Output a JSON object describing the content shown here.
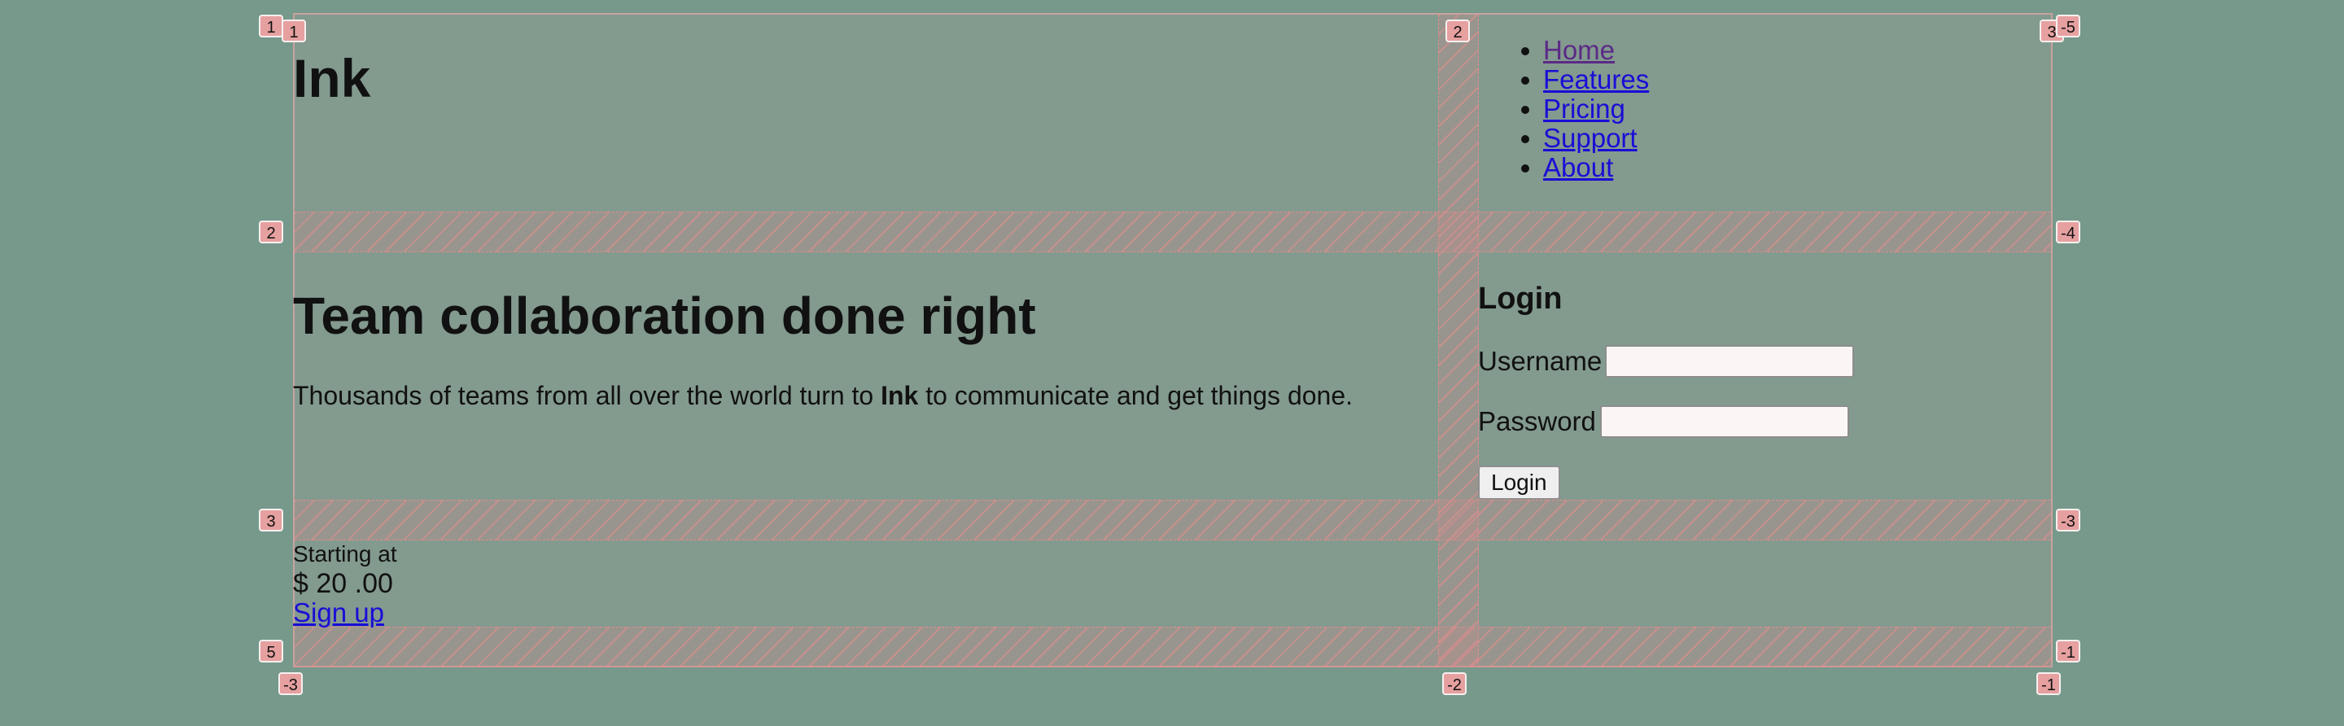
{
  "header": {
    "site_title": "Ink",
    "nav": [
      "Home",
      "Features",
      "Pricing",
      "Support",
      "About"
    ]
  },
  "hero": {
    "title": "Team collaboration done right",
    "text_before": "Thousands of teams from all over the world turn to ",
    "text_brand": "Ink",
    "text_after": " to communicate and get things done."
  },
  "login": {
    "title": "Login",
    "username_label": "Username",
    "username_value": "",
    "password_label": "Password",
    "password_value": "",
    "button_label": "Login"
  },
  "pricing": {
    "starting_label": "Starting at",
    "currency": "$",
    "amount": "20",
    "cents": ".00",
    "signup_label": "Sign up"
  },
  "grid_overlay": {
    "top_badges": [
      "1",
      "2",
      "3"
    ],
    "bottom_badges": [
      "-3",
      "-2",
      "-1"
    ],
    "left_badges": [
      "1",
      "2",
      "3",
      "5"
    ],
    "right_badges": [
      "-5",
      "-4",
      "-3",
      "-1"
    ],
    "overlay_color": "#e6a0a0"
  },
  "colors": {
    "page_background": "#76998b",
    "grid_background": "#839a8f",
    "link": "#1a0dd6",
    "visited_link": "#5b2a86"
  }
}
